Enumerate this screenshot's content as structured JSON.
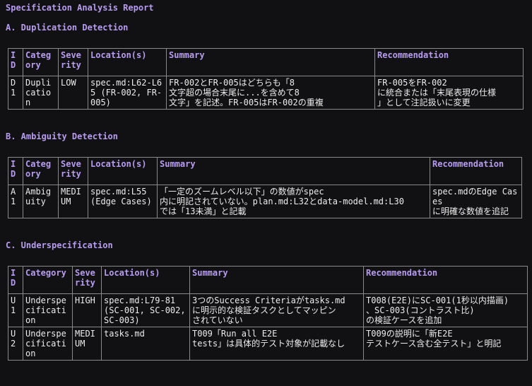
{
  "report_title": "Specification Analysis Report",
  "sections": [
    {
      "title": "A. Duplication Detection",
      "headers": [
        "ID",
        "Category",
        "Severity",
        "Location(s)",
        "Summary",
        "Recommendation"
      ],
      "rows": [
        {
          "id": "D1",
          "category": "Duplication",
          "severity": "LOW",
          "location": "spec.md:L62-L65 (FR-002, FR-005)",
          "summary": "FR-002とFR-005はどちらも「8\n文字超の場合末尾に...を含めて8\n文字」を記述。FR-005はFR-002の重複",
          "recommendation": "FR-005をFR-002\nに統合または「末尾表現の仕様\n」として注記扱いに変更"
        }
      ]
    },
    {
      "title": "B. Ambiguity Detection",
      "headers": [
        "ID",
        "Category",
        "Severity",
        "Location(s)",
        "Summary",
        "Recommendation"
      ],
      "rows": [
        {
          "id": "A1",
          "category": "Ambiguity",
          "severity": "MEDIUM",
          "location": "spec.md:L55 (Edge Cases)",
          "summary": "「一定のズームレベル以下」の数値がspec\n内に明記されていない。plan.md:L32とdata-model.md:L30\nでは「13未満」と記載",
          "recommendation": "spec.mdのEdge Cases\nに明確な数値を追記"
        }
      ]
    },
    {
      "title": "C. Underspecification",
      "headers": [
        "ID",
        "Category",
        "Severity",
        "Location(s)",
        "Summary",
        "Recommendation"
      ],
      "rows": [
        {
          "id": "U1",
          "category": "Underspecification",
          "severity": "HIGH",
          "location": "spec.md:L79-81 (SC-001, SC-002, SC-003)",
          "summary": "3つのSuccess Criteriaがtasks.md\nに明示的な検証タスクとしてマッピン\nされていない",
          "recommendation": "T008(E2E)にSC-001(1秒以内描画)\n、SC-003(コントラスト比)\nの検証ケースを追加"
        },
        {
          "id": "U2",
          "category": "Underspecification",
          "severity": "MEDIUM",
          "location": "tasks.md",
          "summary": "T009「Run all E2E\ntests」は具体的テスト対象が記載なし",
          "recommendation": "T009の説明に「新E2E\nテストケース含む全テスト」と明記"
        }
      ]
    }
  ]
}
